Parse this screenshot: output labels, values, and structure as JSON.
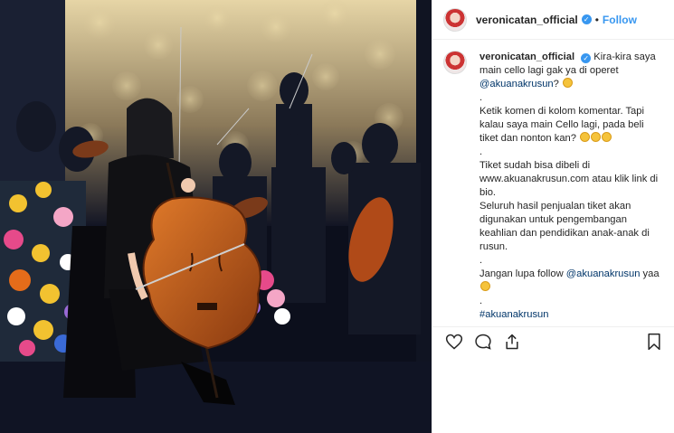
{
  "post": {
    "username": "veronicatan_official",
    "follow_label": "Follow",
    "separator": "•",
    "photo_alt": "cello player on stage",
    "caption": {
      "username": "veronicatan_official",
      "line1": "Kira-kira saya main cello lagi gak ya di operet",
      "mention1": "@akuanakrusun",
      "line1_end": "?",
      "sep1": ".",
      "para2": "Ketik komen di kolom komentar. Tapi kalau saya main Cello lagi, pada beli tiket dan nonton kan?",
      "sep2": ".",
      "para3": "Tiket sudah bisa dibeli di www.akuanakrusun.com atau klik link di bio.",
      "para4": "Seluruh hasil penjualan tiket akan digunakan untuk pengembangan keahlian dan pendidikan anak-anak di rusun.",
      "sep3": ".",
      "para5": "Jangan lupa follow",
      "mention2": "@akuanakrusun",
      "para5_end": "yaa",
      "sep4": ".",
      "hashtag": "#akuanakrusun"
    },
    "icons": {
      "like": "heart-icon",
      "comment": "comment-icon",
      "share": "share-icon",
      "save": "bookmark-icon"
    },
    "colors": {
      "link_blue": "#3897f0",
      "mention": "#003569"
    }
  }
}
